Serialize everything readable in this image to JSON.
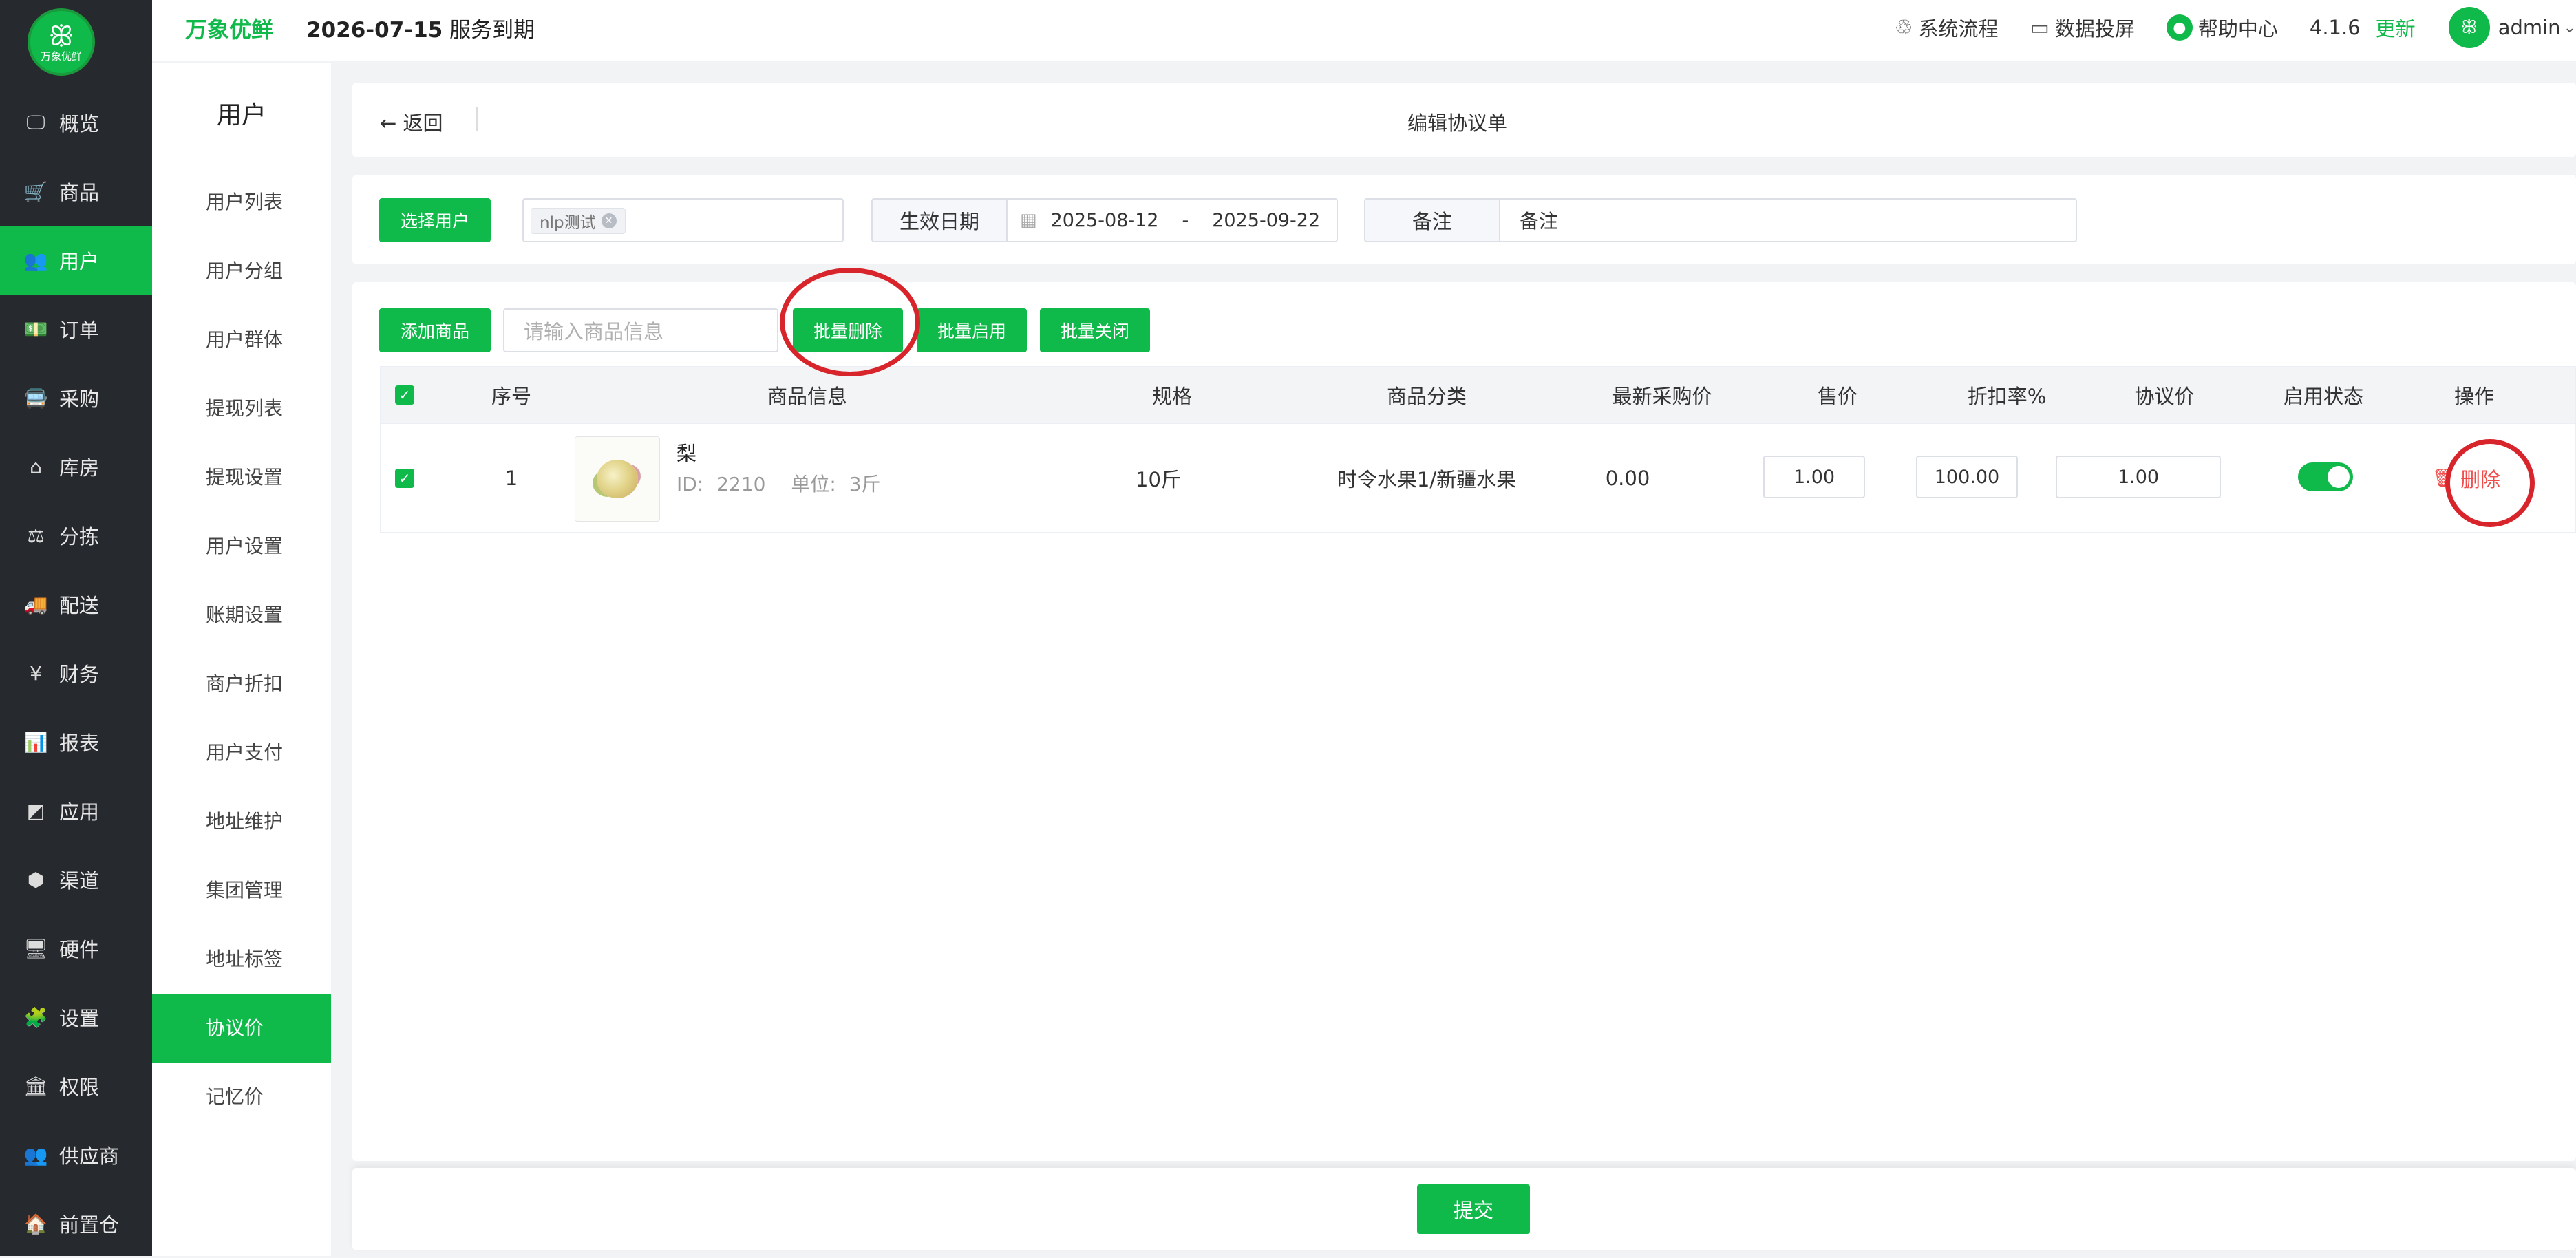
{
  "app": {
    "logo_text": "万象优鲜",
    "brand": "万象优鲜",
    "expire_date": "2026-07-15",
    "expire_label": "服务到期"
  },
  "header": {
    "workflow": "系统流程",
    "dashboard": "数据投屏",
    "help": "帮助中心",
    "version": "4.1.6",
    "update": "更新",
    "user": "admin"
  },
  "sidebar": {
    "items": [
      {
        "label": "概览",
        "icon": "monitor-icon"
      },
      {
        "label": "商品",
        "icon": "cart-icon"
      },
      {
        "label": "用户",
        "icon": "users-icon"
      },
      {
        "label": "订单",
        "icon": "money-icon"
      },
      {
        "label": "采购",
        "icon": "truck-icon"
      },
      {
        "label": "库房",
        "icon": "home-icon"
      },
      {
        "label": "分拣",
        "icon": "scale-icon"
      },
      {
        "label": "配送",
        "icon": "delivery-icon"
      },
      {
        "label": "财务",
        "icon": "yen-icon"
      },
      {
        "label": "报表",
        "icon": "bar-chart-icon"
      },
      {
        "label": "应用",
        "icon": "apps-icon"
      },
      {
        "label": "渠道",
        "icon": "cube-icon"
      },
      {
        "label": "硬件",
        "icon": "desktop-icon"
      },
      {
        "label": "设置",
        "icon": "puzzle-icon"
      },
      {
        "label": "权限",
        "icon": "bank-icon"
      },
      {
        "label": "供应商",
        "icon": "users-icon"
      },
      {
        "label": "前置仓",
        "icon": "warehouse-icon"
      }
    ],
    "active": "用户"
  },
  "subnav": {
    "title": "用户",
    "items": [
      "用户列表",
      "用户分组",
      "用户群体",
      "提现列表",
      "提现设置",
      "用户设置",
      "账期设置",
      "商户折扣",
      "用户支付",
      "地址维护",
      "集团管理",
      "地址标签",
      "协议价",
      "记忆价"
    ],
    "active": "协议价"
  },
  "page": {
    "back": "返回",
    "title": "编辑协议单"
  },
  "form": {
    "select_user": "选择用户",
    "user_tag": "nlp测试",
    "effective_label": "生效日期",
    "date_start": "2025-08-12",
    "date_sep": "-",
    "date_end": "2025-09-22",
    "remark_label": "备注",
    "remark_value": "备注"
  },
  "toolbar": {
    "add_product": "添加商品",
    "search_placeholder": "请输入商品信息",
    "batch_delete": "批量删除",
    "batch_enable": "批量启用",
    "batch_close": "批量关闭"
  },
  "table": {
    "columns": [
      "序号",
      "商品信息",
      "规格",
      "商品分类",
      "最新采购价",
      "售价",
      "折扣率%",
      "协议价",
      "启用状态",
      "操作"
    ],
    "rows": [
      {
        "index": "1",
        "name": "梨",
        "id_label": "ID:",
        "id": "2210",
        "unit_label": "单位:",
        "unit": "3斤",
        "spec": "10斤",
        "category": "时令水果1/新疆水果",
        "last_price": "0.00",
        "sale_price": "1.00",
        "discount": "100.00",
        "agreement_price": "1.00",
        "enabled": true,
        "action": "删除"
      }
    ]
  },
  "footer": {
    "submit": "提交"
  },
  "colors": {
    "accent": "#0fba4a",
    "sidebar_bg": "#26292e",
    "danger": "#f04b4b",
    "annotation": "#d8252c"
  }
}
